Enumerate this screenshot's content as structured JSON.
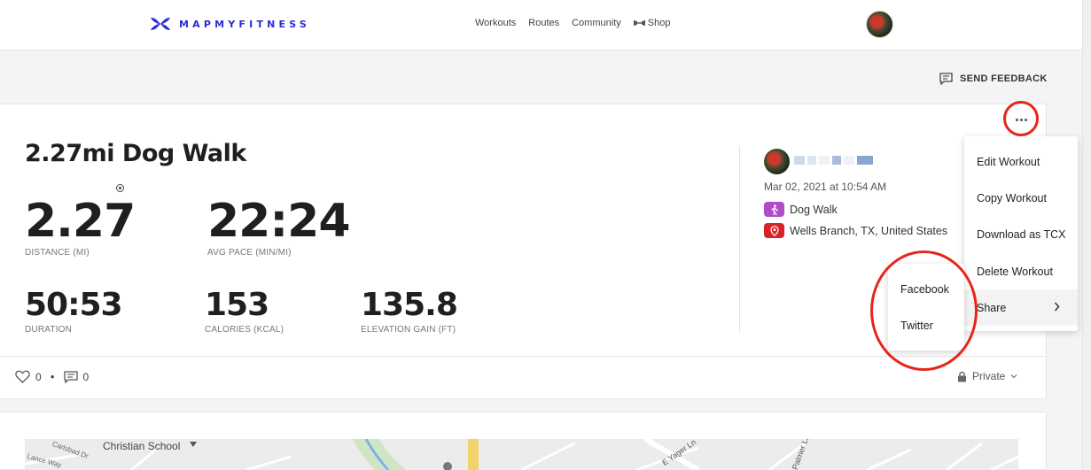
{
  "brand": {
    "name": "MAPMYFITNESS",
    "color": "#2b2fd0"
  },
  "nav": {
    "workouts": "Workouts",
    "routes": "Routes",
    "community": "Community",
    "shop": "Shop"
  },
  "feedback_label": "SEND FEEDBACK",
  "workout": {
    "title": "2.27mi Dog Walk",
    "stats": {
      "distance": {
        "value": "2.27",
        "label": "DISTANCE (MI)"
      },
      "pace": {
        "value": "22:24",
        "label": "AVG PACE (MIN/MI)"
      },
      "duration": {
        "value": "50:53",
        "label": "DURATION"
      },
      "calories": {
        "value": "153",
        "label": "CALORIES (KCAL)"
      },
      "elevation": {
        "value": "135.8",
        "label": "ELEVATION GAIN (FT)"
      }
    },
    "date": "Mar 02, 2021 at 10:54 AM",
    "activity": "Dog Walk",
    "location": "Wells Branch, TX, United States",
    "likes": "0",
    "comments": "0",
    "privacy": "Private"
  },
  "menu": {
    "items": [
      "Edit Workout",
      "Copy Workout",
      "Download as TCX",
      "Delete Workout",
      "Share"
    ]
  },
  "share_menu": {
    "items": [
      "Facebook",
      "Twitter"
    ]
  },
  "map": {
    "labels": [
      "Christian School",
      "Carlsbad Dr",
      "Lance Way",
      "E Yager Ln",
      "Palmer Ln"
    ]
  },
  "colors": {
    "highlight": "#e8251a",
    "activity_badge": "#b04bc9",
    "location_badge": "#d8232a"
  }
}
